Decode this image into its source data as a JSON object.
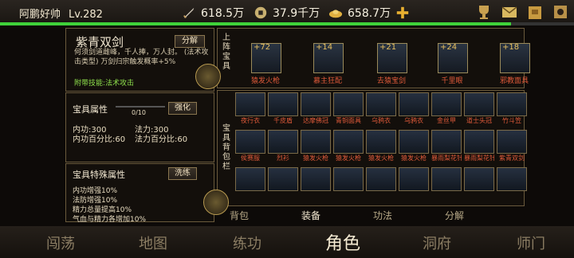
{
  "player": {
    "name": "阿鹏好帅",
    "level": "Lv.282"
  },
  "resources": {
    "power": "618.5万",
    "coin": "37.9千万",
    "ingot": "658.7万"
  },
  "hp_fraction": 0.89,
  "item": {
    "name": "紫青双剑",
    "decompose": "分解",
    "desc": "何须剑道雌峰，千人捧，万人封。 (法术攻击类型) 万剑归宗触发概率+5%",
    "skill": "附带技能:法术攻击"
  },
  "attr": {
    "title": "宝具属性",
    "progress": "0/10",
    "strengthen": "强化",
    "neigong": "内功:300",
    "fali": "法力:300",
    "neigong_pct": "内功百分比:60",
    "fali_pct": "法力百分比:60"
  },
  "special": {
    "title": "宝具特殊属性",
    "wash": "洗练",
    "lines": [
      "内功增强10%",
      "法防增强10%",
      "精力总量提高10%",
      "气血与精力各增加10%"
    ]
  },
  "equip_label": "上阵宝具",
  "bag_label": "宝具背包栏",
  "equipped": [
    {
      "plus": "+72",
      "name": "猿发火枪"
    },
    {
      "plus": "+14",
      "name": "慕主狂配"
    },
    {
      "plus": "+21",
      "name": "去猿宝剑"
    },
    {
      "plus": "+24",
      "name": "千里眼"
    },
    {
      "plus": "+18",
      "name": "邪教面具"
    }
  ],
  "bag": [
    "夜行衣",
    "千皮盾",
    "达摩佛冠",
    "青铜面具",
    "乌鸦衣",
    "乌鸦衣",
    "金丝甲",
    "道士头冠",
    "竹斗笠",
    "侯赛服",
    "烈衫",
    "猿发火枪",
    "猿发火枪",
    "猿发火枪",
    "猿发火枪",
    "暴雨梨花针",
    "暴雨梨花针",
    "紫青双剑",
    "",
    "",
    "",
    "",
    "",
    "",
    "",
    "",
    ""
  ],
  "subtabs": [
    "背包",
    "装备",
    "功法",
    "分解"
  ],
  "nav": [
    "闯荡",
    "地图",
    "练功",
    "角色",
    "洞府",
    "师门"
  ],
  "colors": {
    "accent": "#e8c060",
    "hp": "#3fd23a",
    "skill": "#8ee04c",
    "item_name": "#e05a3a"
  },
  "icons": [
    "sword-icon",
    "coin-icon",
    "ingot-icon",
    "plus-icon",
    "trophy-icon",
    "mail-icon",
    "bag-icon",
    "settings-icon"
  ]
}
